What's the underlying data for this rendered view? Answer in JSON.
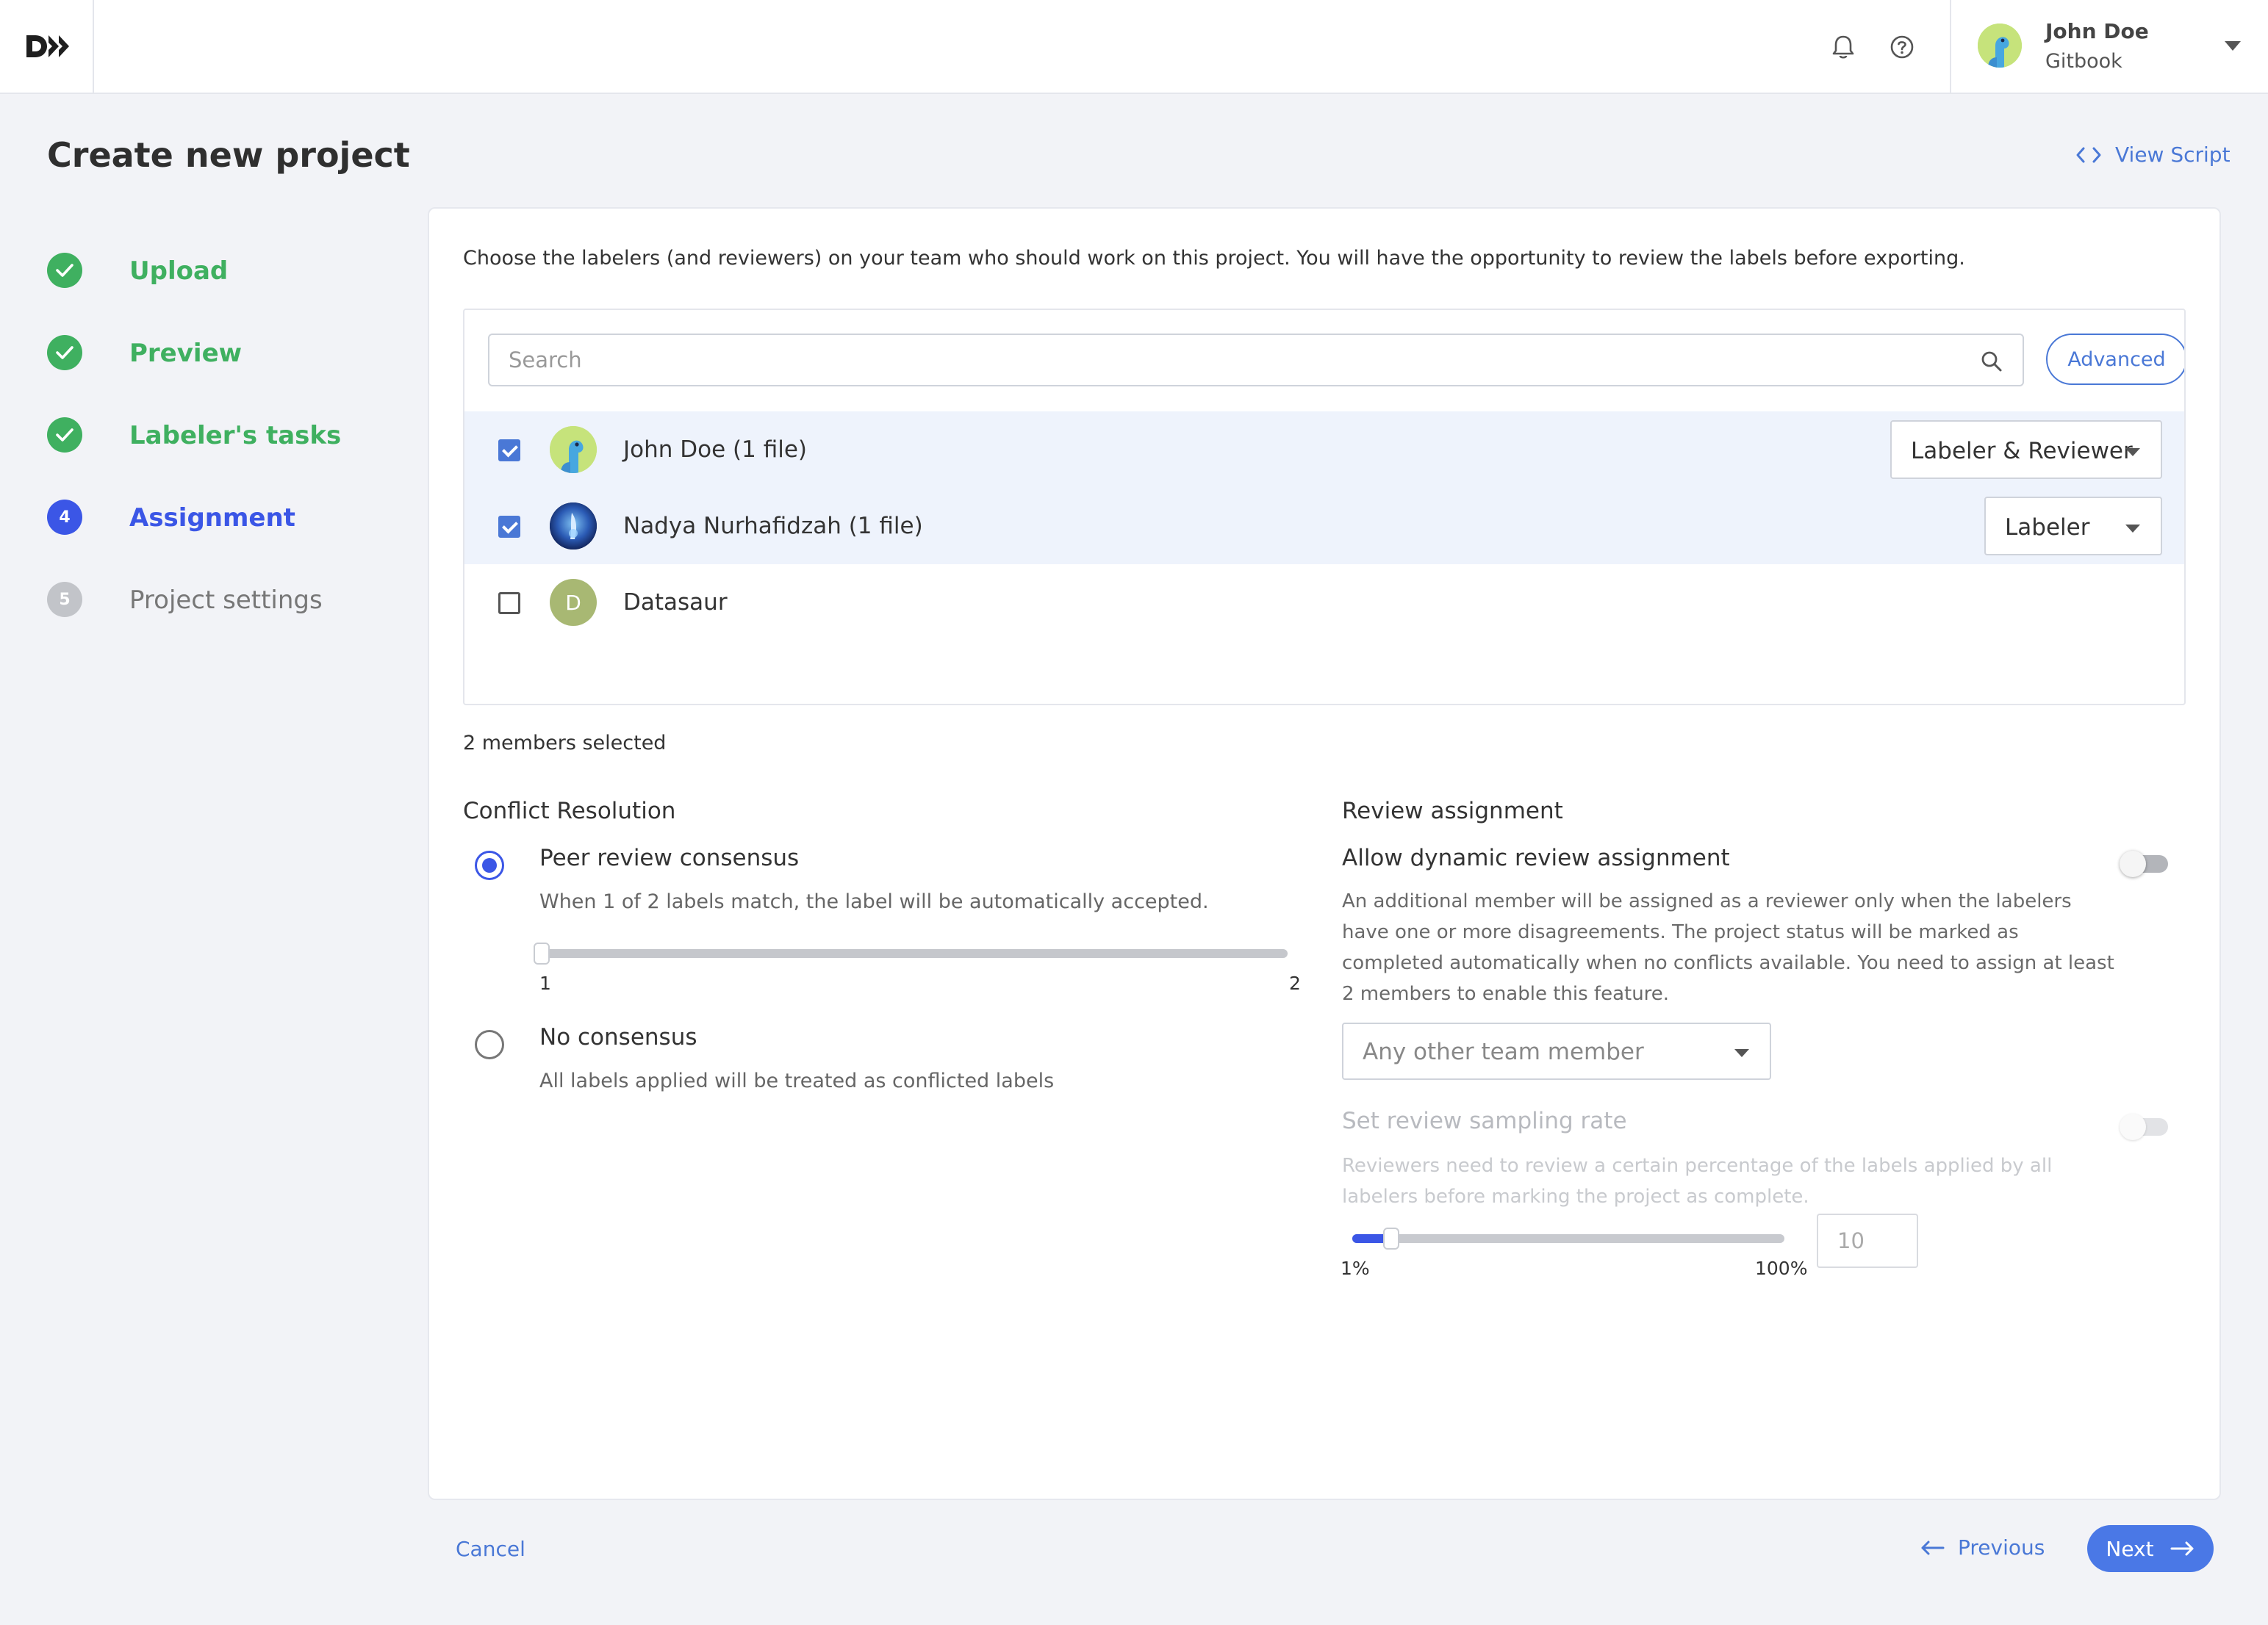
{
  "app": {
    "user": {
      "name": "John Doe",
      "organization": "Gitbook"
    }
  },
  "header": {
    "title": "Create new project",
    "view_script": "View Script"
  },
  "steps": [
    {
      "number": "1",
      "label": "Upload",
      "status": "done"
    },
    {
      "number": "2",
      "label": "Preview",
      "status": "done"
    },
    {
      "number": "3",
      "label": "Labeler's tasks",
      "status": "done"
    },
    {
      "number": "4",
      "label": "Assignment",
      "status": "active"
    },
    {
      "number": "5",
      "label": "Project settings",
      "status": "pending"
    }
  ],
  "assignment": {
    "intro": "Choose the labelers (and reviewers) on your team who should work on this project. You will have the opportunity to review the labels before exporting.",
    "search_placeholder": "Search",
    "advanced_label": "Advanced",
    "members": [
      {
        "name": "John Doe (1 file)",
        "checked": true,
        "role": "Labeler & Reviewer",
        "avatar_icon": "dino-avatar-icon"
      },
      {
        "name": "Nadya Nurhafidzah (1 file)",
        "checked": true,
        "role": "Labeler",
        "avatar_icon": "photo-avatar-icon"
      },
      {
        "name": "Datasaur",
        "checked": false,
        "role": "",
        "avatar_initial": "D"
      }
    ],
    "selected_count": "2 members selected"
  },
  "conflict_resolution": {
    "title": "Conflict Resolution",
    "options": [
      {
        "title": "Peer review consensus",
        "description": "When 1 of 2 labels match, the label will be automatically accepted.",
        "selected": true
      },
      {
        "title": "No consensus",
        "description": "All labels applied will be treated as conflicted labels",
        "selected": false
      }
    ],
    "slider": {
      "value": 1,
      "min_label": "1",
      "max_label": "2"
    }
  },
  "review_assignment": {
    "title": "Review assignment",
    "dynamic": {
      "title": "Allow dynamic review assignment",
      "enabled": false,
      "description": "An additional member will be assigned as a reviewer only when the labelers have one or more disagreements. The project status will be marked as completed automatically when no conflicts available. You need to assign at least 2 members to enable this feature.",
      "member_select": "Any other team member"
    },
    "sampling": {
      "title": "Set review sampling rate",
      "enabled": false,
      "description": "Reviewers need to review a certain percentage of the labels applied by all labelers before marking the project as complete.",
      "min_label": "1%",
      "max_label": "100%",
      "value": "10"
    }
  },
  "footer": {
    "cancel": "Cancel",
    "previous": "Previous",
    "next": "Next"
  },
  "colors": {
    "accent": "#3b56e6",
    "link": "#4a78d6",
    "success": "#3fb060"
  }
}
